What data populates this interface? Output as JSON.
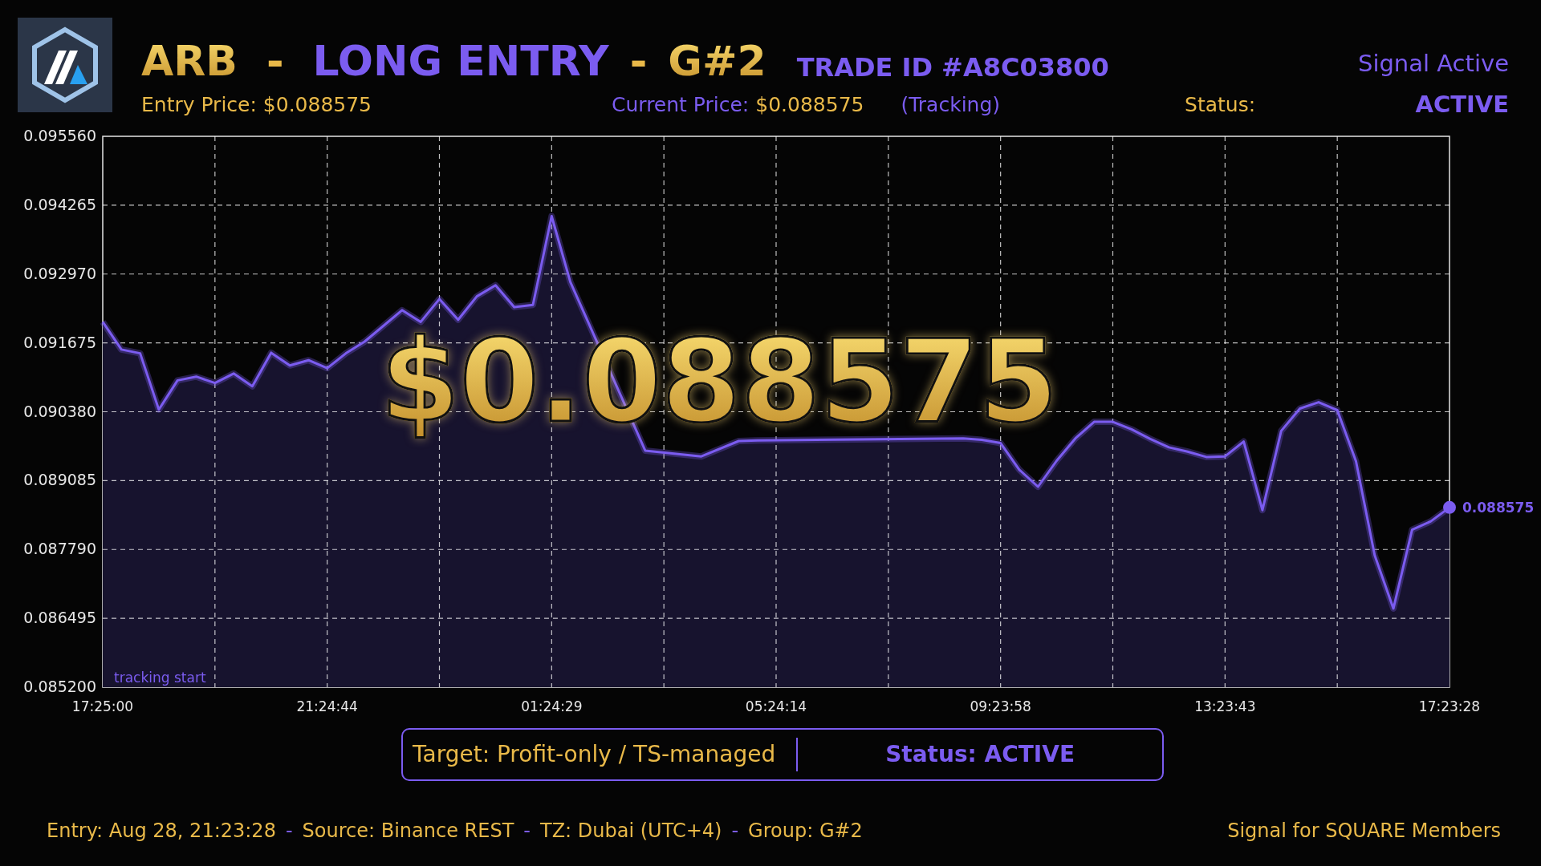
{
  "header": {
    "symbol": "ARB",
    "separator_1": "-",
    "direction": "LONG ENTRY",
    "separator_2": "-",
    "group": "G#2",
    "trade_id": "TRADE ID #A8C03800",
    "signal_state": "Signal Active",
    "entry_price": "Entry Price: $0.088575",
    "current_price_label": "Current Price:",
    "current_price": "$0.088575",
    "tracking": "(Tracking)",
    "status_label": "Status:",
    "status": "ACTIVE"
  },
  "chart": {
    "price_overlay": "$0.088575",
    "chart_data": {
      "type": "area",
      "grid": true,
      "ylim": [
        0.0852,
        0.09556
      ],
      "categories": [
        "17:25:00",
        null,
        null,
        null,
        null,
        null,
        null,
        null,
        null,
        null,
        null,
        null,
        "21:24:44",
        null,
        null,
        null,
        null,
        null,
        null,
        null,
        null,
        null,
        null,
        null,
        "01:24:29",
        null,
        null,
        null,
        null,
        null,
        null,
        null,
        null,
        null,
        null,
        null,
        "05:24:14",
        null,
        null,
        null,
        null,
        null,
        null,
        null,
        null,
        null,
        null,
        null,
        "09:23:58",
        null,
        null,
        null,
        null,
        null,
        null,
        null,
        null,
        null,
        null,
        null,
        "13:23:43",
        null,
        null,
        null,
        null,
        null,
        null,
        null,
        null,
        null,
        null,
        null,
        "17:23:28"
      ],
      "yticks": [
        {
          "value": 0.0852,
          "label": "0.085200"
        },
        {
          "value": 0.086495,
          "label": "0.086495"
        },
        {
          "value": 0.08779,
          "label": "0.087790"
        },
        {
          "value": 0.089085,
          "label": "0.089085"
        },
        {
          "value": 0.09038,
          "label": "0.090380"
        },
        {
          "value": 0.091675,
          "label": "0.091675"
        },
        {
          "value": 0.09297,
          "label": "0.092970"
        },
        {
          "value": 0.094265,
          "label": "0.094265"
        },
        {
          "value": 0.09556,
          "label": "0.095560"
        }
      ],
      "series": [
        {
          "color": "#7b5cf0",
          "values": [
            0.09207,
            0.09155,
            0.09148,
            0.09042,
            0.09097,
            0.09104,
            0.09092,
            0.0911,
            0.09086,
            0.09149,
            0.09125,
            0.09135,
            0.0912,
            0.09148,
            0.0917,
            null,
            0.09229,
            0.09207,
            0.0925,
            0.09211,
            0.09255,
            0.09276,
            0.09235,
            0.09239,
            0.09406,
            0.09282,
            null,
            null,
            null,
            0.08965,
            null,
            null,
            0.08954,
            null,
            0.08983,
            0.08984,
            null,
            null,
            null,
            null,
            null,
            null,
            null,
            null,
            null,
            null,
            0.08988,
            0.08985,
            0.08979,
            0.08929,
            0.08897,
            0.08946,
            0.08988,
            0.09019,
            0.09019,
            0.09005,
            0.08987,
            0.08971,
            0.08963,
            0.08953,
            0.08954,
            0.08982,
            0.08853,
            0.09002,
            0.09044,
            0.09056,
            0.09041,
            0.08945,
            0.08768,
            0.08668,
            0.08816,
            0.08832,
            0.08858
          ]
        }
      ],
      "annotations": [
        "tracking start",
        "0.088575"
      ]
    }
  },
  "summary": {
    "target": "Target: Profit-only / TS-managed",
    "status": "Status: ACTIVE"
  },
  "footer": {
    "parts": [
      {
        "kind": "field",
        "text": "Entry: Aug 28, 21:23:28"
      },
      {
        "kind": "separator",
        "text": "-"
      },
      {
        "kind": "field",
        "text": "Source: Binance REST"
      },
      {
        "kind": "separator",
        "text": "-"
      },
      {
        "kind": "field",
        "text": "TZ: Dubai (UTC+4)"
      },
      {
        "kind": "separator",
        "text": "-"
      },
      {
        "kind": "field",
        "text": "Group: G#2"
      }
    ],
    "note": "Signal for SQUARE Members"
  }
}
